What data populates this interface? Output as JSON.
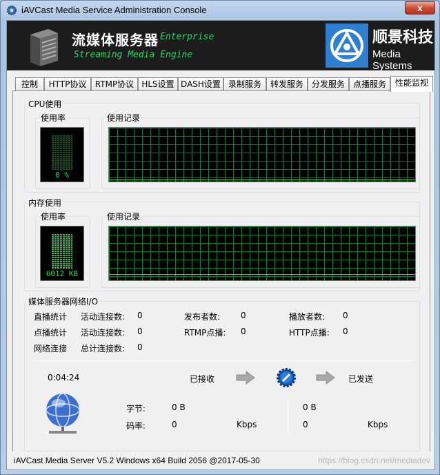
{
  "window": {
    "title": "iAVCast Media Service Administration Console",
    "close_label": "x"
  },
  "banner": {
    "title": "流媒体服务器",
    "edition": "Enterprise",
    "subtitle": "Streaming Media Engine",
    "company_cn": "顺景科技",
    "company_en": "Media Systems"
  },
  "tabs": [
    {
      "label": "控制"
    },
    {
      "label": "HTTP协议"
    },
    {
      "label": "RTMP协议"
    },
    {
      "label": "HLS设置"
    },
    {
      "label": "DASH设置"
    },
    {
      "label": "录制服务"
    },
    {
      "label": "转发服务"
    },
    {
      "label": "分发服务"
    },
    {
      "label": "点播服务"
    },
    {
      "label": "性能监视"
    }
  ],
  "active_tab": "性能监视",
  "cpu": {
    "group_label": "CPU使用",
    "usage_label": "使用率",
    "history_label": "使用记录",
    "value": "0 %"
  },
  "memory": {
    "group_label": "内存使用",
    "usage_label": "使用率",
    "history_label": "使用记录",
    "value": "6012 KB"
  },
  "network": {
    "group_label": "媒体服务器网络I/O",
    "live_label": "直播统计",
    "vod_label": "点播统计",
    "conn_label": "网络连接",
    "active_conn_label": "活动连接数:",
    "total_conn_label": "总计连接数:",
    "live_active": "0",
    "vod_active": "0",
    "total_conn": "0",
    "publishers_label": "发布者数:",
    "publishers": "0",
    "rtmp_vod_label": "RTMP点播:",
    "rtmp_vod": "0",
    "players_label": "播放者数:",
    "players": "0",
    "http_vod_label": "HTTP点播:",
    "http_vod": "0",
    "uptime": "0:04:24",
    "received_label": "已接收",
    "sent_label": "已发送",
    "bytes_label": "字节:",
    "rate_label": "码率:",
    "rx_bytes": "0 B",
    "tx_bytes": "0 B",
    "rx_rate": "0",
    "tx_rate": "0",
    "rate_unit": "Kbps"
  },
  "status": {
    "text": "iAVCast Media Server V5.2 Windows x64 Build 2056 @2017-05-30",
    "watermark": "https://blog.csdn.net/mediadev"
  }
}
